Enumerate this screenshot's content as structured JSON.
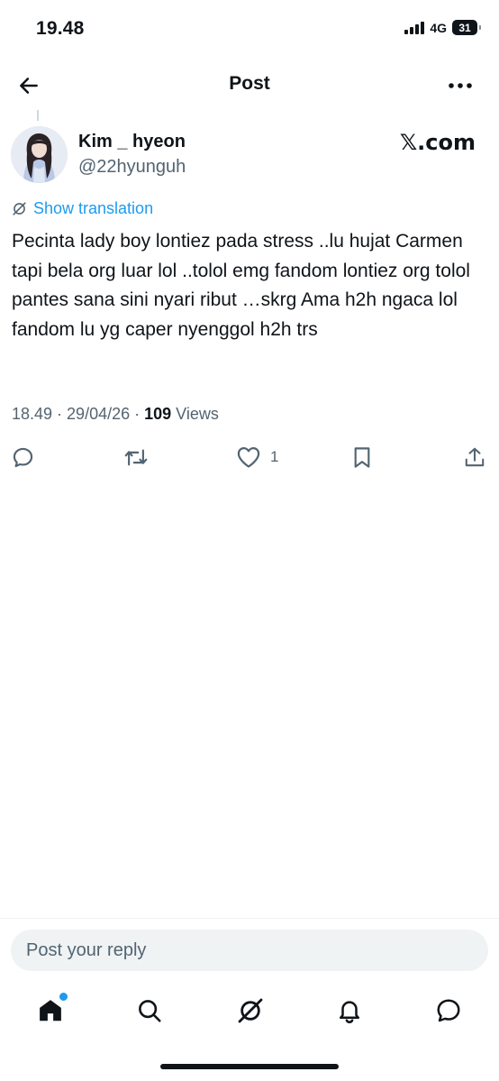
{
  "status_bar": {
    "time": "19.48",
    "network": "4G",
    "battery": "31"
  },
  "header": {
    "title": "Post"
  },
  "post": {
    "author": {
      "display_name": "Kim _ hyeon",
      "handle": "@22hyunguh"
    },
    "source_label": "𝕏.com",
    "translation_link": "Show translation",
    "text": "Pecinta lady boy lontiez pada stress ..lu hujat Carmen tapi bela org luar lol ..tolol emg fandom lontiez org tolol pantes sana sini nyari ribut …skrg Ama h2h ngaca lol fandom lu yg caper nyenggol h2h trs",
    "meta": {
      "time": "18.49",
      "separator": " · ",
      "date": "29/04/26",
      "views_count": "109",
      "views_label": " Views"
    },
    "actions": {
      "reply_icon": "reply-icon",
      "repost_icon": "repost-icon",
      "like_icon": "heart-icon",
      "like_count": "1",
      "bookmark_icon": "bookmark-icon",
      "share_icon": "share-icon"
    }
  },
  "reply": {
    "placeholder": "Post your reply"
  },
  "tabbar": {
    "items": [
      "home-icon",
      "search-icon",
      "grok-icon",
      "bell-icon",
      "messages-icon"
    ]
  },
  "colors": {
    "accent": "#1d9bf0",
    "text": "#0f1419",
    "secondary": "#536471",
    "reply_bg": "#eff3f4"
  }
}
